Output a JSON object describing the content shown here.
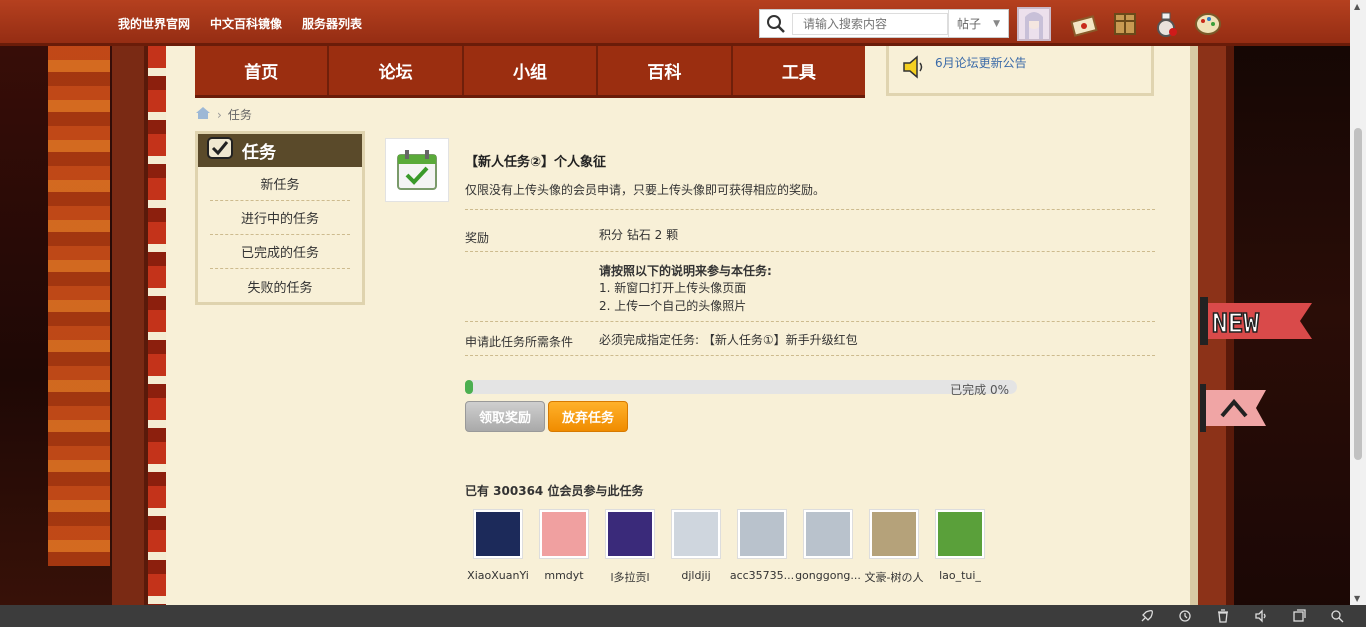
{
  "topbar": {
    "links": [
      "我的世界官网",
      "中文百科镜像",
      "服务器列表"
    ],
    "search_placeholder": "请输入搜索内容",
    "search_scope": "帖子"
  },
  "nav": {
    "items": [
      "首页",
      "论坛",
      "小组",
      "百科",
      "工具"
    ]
  },
  "notice": {
    "text": "6月论坛更新公告"
  },
  "breadcrumb": {
    "current": "任务"
  },
  "side": {
    "title": "任务",
    "items": [
      "新任务",
      "进行中的任务",
      "已完成的任务",
      "失败的任务"
    ]
  },
  "task": {
    "title": "【新人任务②】个人象征",
    "description": "仅限没有上传头像的会员申请，只要上传头像即可获得相应的奖励。",
    "reward_label": "奖励",
    "reward_value": "积分 钻石 2 颗",
    "instructions_heading": "请按照以下的说明来参与本任务:",
    "instruction_1": "1. 新窗口打开上传头像页面",
    "instruction_2": "2. 上传一个自己的头像照片",
    "condition_label": "申请此任务所需条件",
    "condition_value": "必须完成指定任务: 【新人任务①】新手升级红包",
    "progress_text": "已完成 0%",
    "progress_percent": 0,
    "claim_button": "领取奖励",
    "quit_button": "放弃任务"
  },
  "members": {
    "title": "已有 300364 位会员参与此任务",
    "list": [
      {
        "name": "XiaoXuanYi",
        "color": "#1c2a5a"
      },
      {
        "name": "mmdyt",
        "color": "#f0a0a0"
      },
      {
        "name": "l多拉贡l",
        "color": "#3a2a7a"
      },
      {
        "name": "djldjij",
        "color": "#cfd6de"
      },
      {
        "name": "acc35735...",
        "color": "#b9c2cc"
      },
      {
        "name": "gonggong...",
        "color": "#b9c2cc"
      },
      {
        "name": "文豪-树の人",
        "color": "#b5a27a"
      },
      {
        "name": "lao_tui_",
        "color": "#5aa03a"
      }
    ]
  },
  "colors": {
    "topbar": "#a3351a",
    "nav": "#9b2e10",
    "parchment": "#f8f0d7",
    "reward": "#e05a2a",
    "quit_button": "#f59a0c",
    "progress_fill": "#4caf50"
  }
}
